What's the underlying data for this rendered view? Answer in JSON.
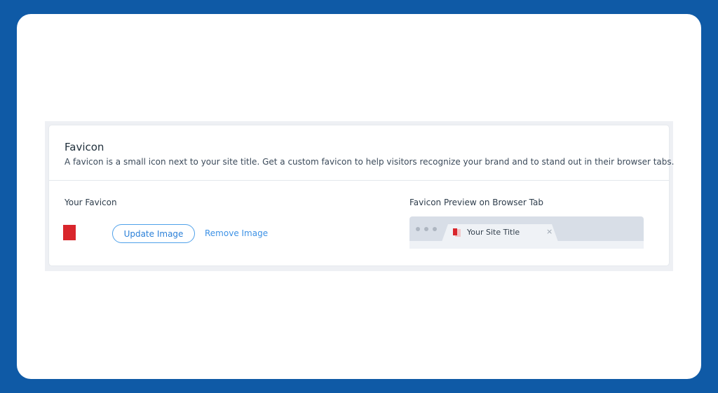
{
  "favicon_section": {
    "title": "Favicon",
    "description": "A favicon is a small icon next to your site title. Get a custom favicon to help visitors recognize your brand and to stand out in their browser tabs.",
    "your_favicon_label": "Your Favicon",
    "update_button_label": "Update Image",
    "remove_link_label": "Remove Image",
    "preview_label": "Favicon Preview on Browser Tab",
    "favicon_color": "#d9262c"
  },
  "browser_preview": {
    "tab_title": "Your Site Title",
    "close_glyph": "×",
    "tab_icon": "favicon-icon"
  },
  "colors": {
    "background": "#0f5aa6",
    "accent": "#2b80d8",
    "favicon_red": "#d9262c"
  }
}
